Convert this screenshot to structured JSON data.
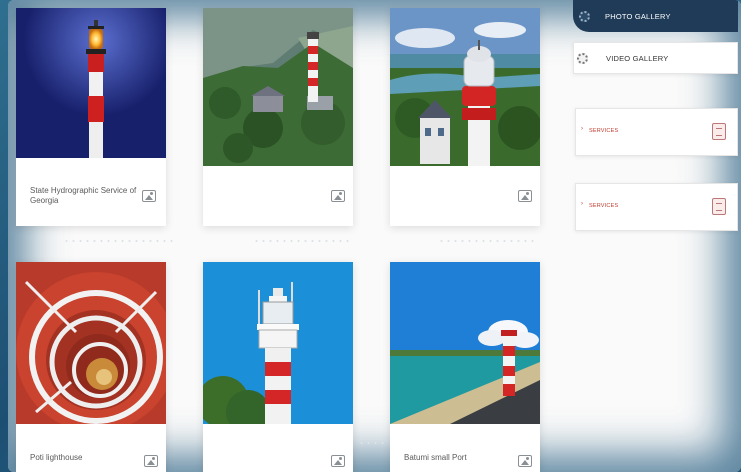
{
  "gallery": {
    "cards": [
      {
        "caption": "State Hydrographic Service of Georgia"
      },
      {
        "caption": ""
      },
      {
        "caption": ""
      },
      {
        "caption": "Poti lighthouse"
      },
      {
        "caption": ""
      },
      {
        "caption": "Batumi small Port"
      }
    ]
  },
  "sidebar": {
    "photo_gallery": "PHOTO GALLERY",
    "video_gallery": "VIDEO GALLERY",
    "services": [
      {
        "label": "SERVICES"
      },
      {
        "label": "SERVICES"
      }
    ]
  },
  "icons": {
    "card_icon": "image-icon",
    "menu_icon": "gear-icon",
    "service_icon": "document-icon"
  },
  "colors": {
    "frame_glow": "#1d4f73",
    "lighthouse_red": "#d62a2a",
    "sky_blue": "#1d8fd6",
    "service_red": "#c0392b"
  }
}
